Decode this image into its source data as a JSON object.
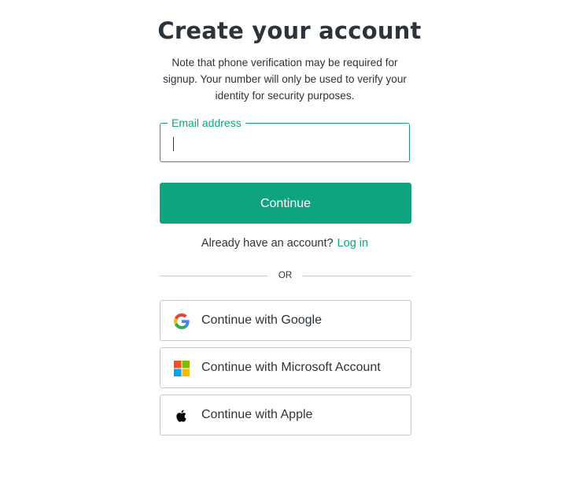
{
  "header": {
    "title": "Create your account",
    "subtitle": "Note that phone verification may be required for signup. Your number will only be used to verify your identity for security purposes."
  },
  "form": {
    "email_label": "Email address",
    "email_value": "",
    "email_placeholder": "",
    "continue_label": "Continue"
  },
  "login": {
    "prompt": "Already have an account?",
    "link_label": "Log in"
  },
  "divider": {
    "label": "OR"
  },
  "social": {
    "google_label": "Continue with Google",
    "microsoft_label": "Continue with Microsoft Account",
    "apple_label": "Continue with Apple"
  },
  "colors": {
    "accent": "#10a37f",
    "text": "#2d333a",
    "border": "#c2c8d0",
    "google_blue": "#4285F4",
    "google_green": "#34A853",
    "google_yellow": "#FBBC05",
    "google_red": "#EA4335",
    "ms_red": "#F25022",
    "ms_green": "#7FBA00",
    "ms_blue": "#00A4EF",
    "ms_yellow": "#FFB900"
  },
  "icons": {
    "google": "google-logo-icon",
    "microsoft": "microsoft-logo-icon",
    "apple": "apple-logo-icon"
  }
}
